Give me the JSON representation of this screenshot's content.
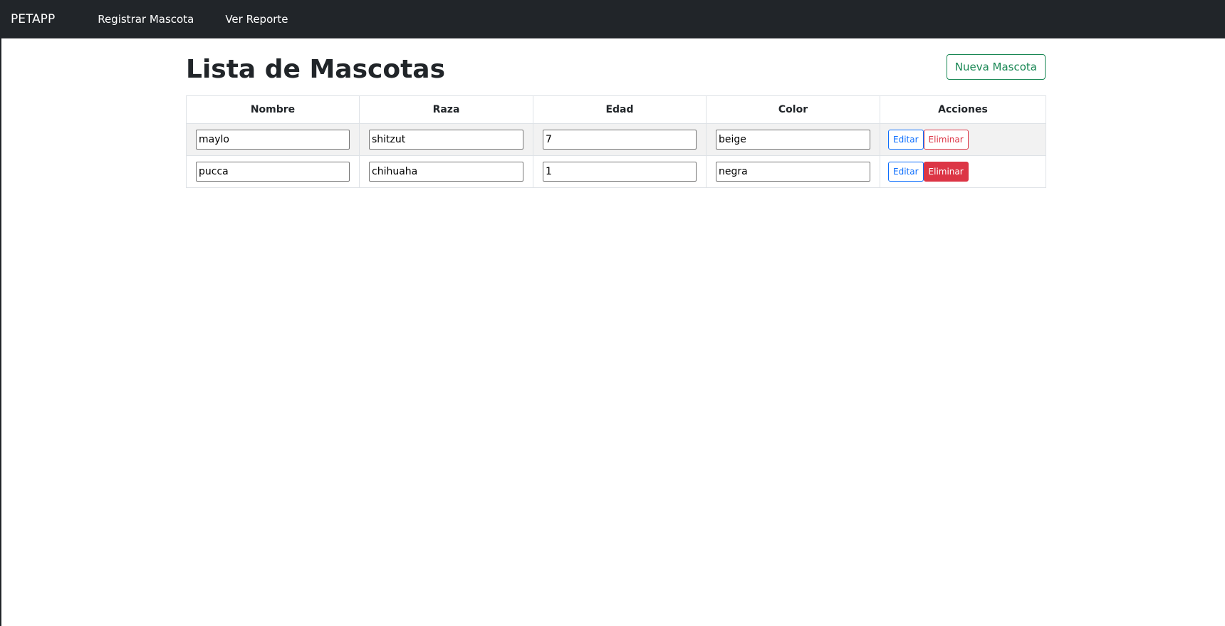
{
  "navbar": {
    "brand": "PETAPP",
    "links": [
      "Registrar Mascota",
      "Ver Reporte"
    ]
  },
  "main": {
    "title": "Lista de Mascotas",
    "new_button_label": "Nueva Mascota"
  },
  "table": {
    "headers": [
      "Nombre",
      "Raza",
      "Edad",
      "Color",
      "Acciones"
    ],
    "rows": [
      {
        "nombre": "maylo",
        "raza": "shitzut",
        "edad": "7",
        "color": "beige"
      },
      {
        "nombre": "pucca",
        "raza": "chihuaha",
        "edad": "1",
        "color": "negra"
      }
    ],
    "edit_label": "Editar",
    "delete_label": "Eliminar"
  },
  "colors": {
    "navbar_bg": "#212529",
    "success": "#198754",
    "primary": "#0d6efd",
    "danger": "#dc3545"
  }
}
